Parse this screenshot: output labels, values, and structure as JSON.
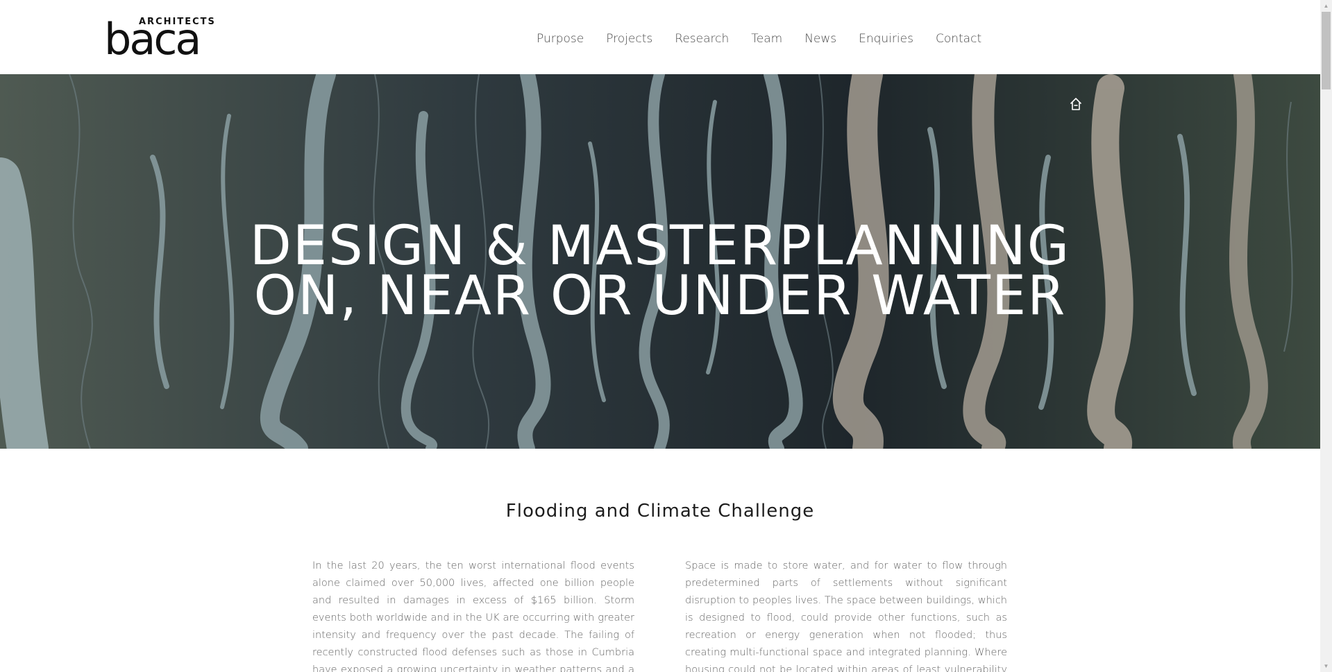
{
  "brand": {
    "architects": "ARCHITECTS",
    "word": "baca"
  },
  "nav": {
    "items": [
      "Purpose",
      "Projects",
      "Research",
      "Team",
      "News",
      "Enquiries",
      "Contact"
    ]
  },
  "hero": {
    "line1": "DESIGN & MASTERPLANNING",
    "line2": "ON, NEAR OR UNDER WATER"
  },
  "section": {
    "title": "Flooding and Climate Challenge",
    "left_text": "In the last 20 years, the ten worst international flood events alone claimed over 50,000 lives, affected one billion people and resulted in damages in excess of $165 billion. Storm events both worldwide and in the UK are occurring with greater intensity and frequency over the past decade. The failing of recently constructed flood defenses such as those in Cumbria have exposed a growing uncertainty in weather patterns and a weakness in relying on",
    "right_text": "Space is made to store water, and for water to flow through predetermined parts of settlements without significant disruption to peoples lives.  The space between buildings, which is designed to flood, could provide other functions, such as recreation or energy generation when not flooded; thus creating multi-functional space and integrated planning. Where housing could not be located within areas of least vulnerability then we developed new building"
  },
  "icons": {
    "home": "home-icon",
    "scroll_up": "chevron-up-icon",
    "scroll_down": "chevron-down-icon"
  }
}
